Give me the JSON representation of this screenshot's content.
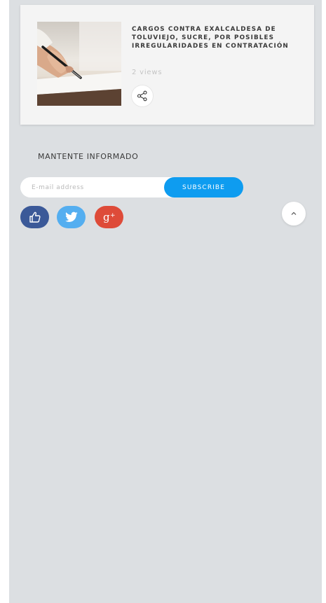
{
  "article": {
    "title": "CARGOS CONTRA EXALCALDESA DE TOLUVIEJO, SUCRE, POR POSIBLES IRREGULARIDADES EN CONTRATACIÓN",
    "views": "2 views",
    "thumbnail_icon": "hand-writing-document-image",
    "share_icon": "share-icon"
  },
  "newsletter": {
    "heading": "MANTENTE INFORMADO",
    "email_placeholder": "E-mail address",
    "email_value": "",
    "subscribe_label": "SUBSCRIBE",
    "accent_color": "#0e9cf0"
  },
  "social": {
    "like_icon": "thumbs-up-icon",
    "twitter_icon": "twitter-icon",
    "gplus_icon": "google-plus-icon",
    "colors": {
      "like": "#3b5998",
      "twitter": "#54aef0",
      "gplus": "#de4b39"
    }
  },
  "scroll_top_icon": "chevron-up-icon"
}
